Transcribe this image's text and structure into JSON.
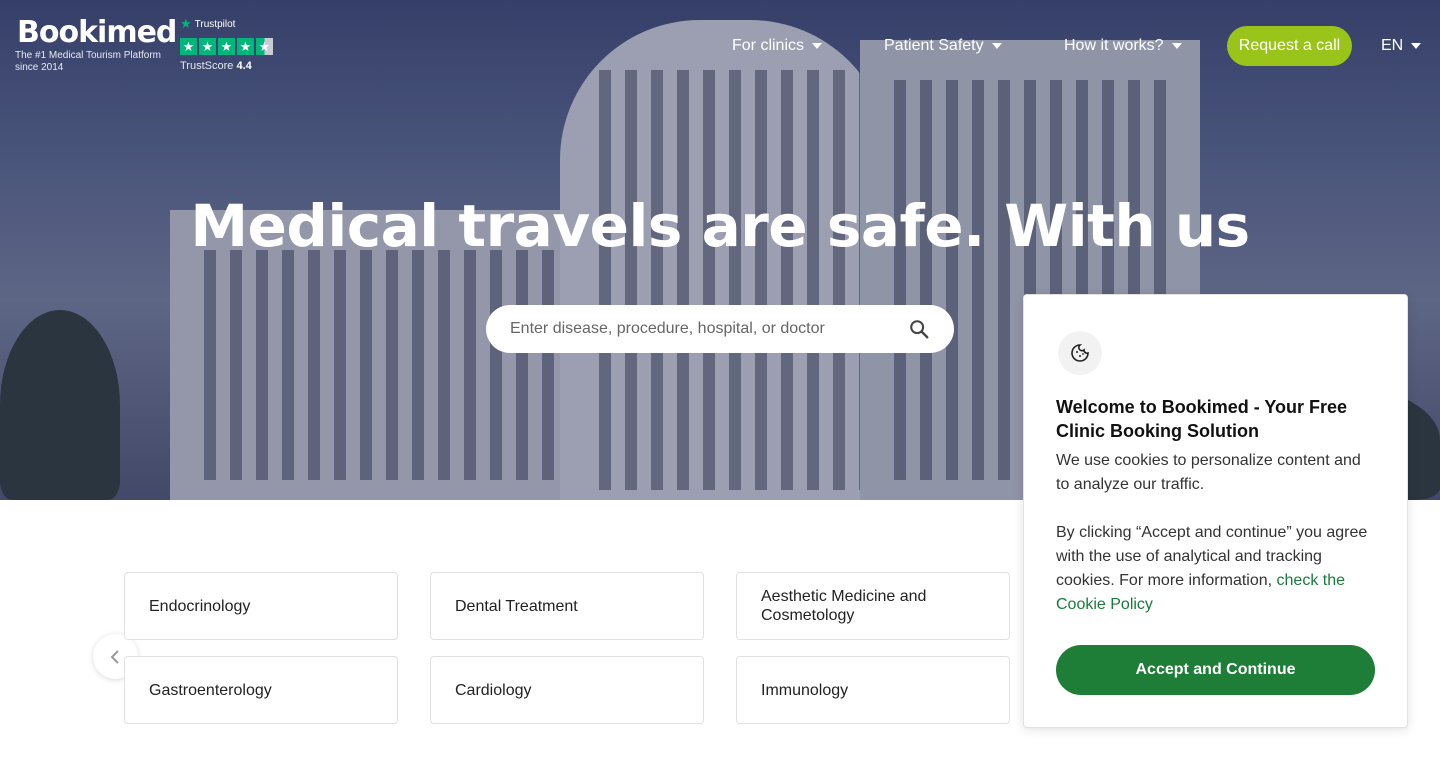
{
  "header": {
    "logo_text": "Bookimed",
    "logo_tagline": "The #1 Medical Tourism Platform since 2014",
    "trustpilot_brand": "Trustpilot",
    "trustscore_label": "TrustScore",
    "trustscore_value": "4.4",
    "nav": [
      {
        "label": "For clinics"
      },
      {
        "label": "Patient Safety"
      },
      {
        "label": "How it works?"
      }
    ],
    "call_button": "Request a call",
    "language": "EN"
  },
  "hero": {
    "title": "Medical travels are safe. With us",
    "search_placeholder": "Enter disease, procedure, hospital, or doctor"
  },
  "categories": [
    {
      "label": "Endocrinology"
    },
    {
      "label": "Dental Treatment"
    },
    {
      "label": "Aesthetic Medicine and Cosmetology"
    },
    {
      "label": "Gastroenterology"
    },
    {
      "label": "Cardiology"
    },
    {
      "label": "Immunology"
    }
  ],
  "cookie": {
    "title": "Welcome to Bookimed - Your Free Clinic Booking Solution",
    "text1": "We use cookies to personalize content and to analyze our traffic.",
    "text2": "By clicking “Accept and continue” you agree with the use of analytical and tracking cookies. For more information,",
    "link": "check the Cookie Policy",
    "accept_button": "Accept and Continue"
  },
  "colors": {
    "brand_green": "#9bc41a",
    "accept_green": "#1e7d37",
    "trustpilot_green": "#00b67a"
  }
}
